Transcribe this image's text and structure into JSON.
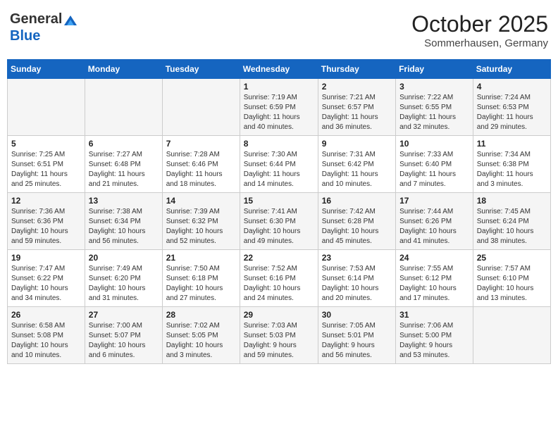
{
  "header": {
    "logo": {
      "general": "General",
      "blue": "Blue"
    },
    "title": "October 2025",
    "location": "Sommerhausen, Germany"
  },
  "weekdays": [
    "Sunday",
    "Monday",
    "Tuesday",
    "Wednesday",
    "Thursday",
    "Friday",
    "Saturday"
  ],
  "weeks": [
    {
      "days": [
        {
          "num": "",
          "info": ""
        },
        {
          "num": "",
          "info": ""
        },
        {
          "num": "",
          "info": ""
        },
        {
          "num": "1",
          "info": "Sunrise: 7:19 AM\nSunset: 6:59 PM\nDaylight: 11 hours\nand 40 minutes."
        },
        {
          "num": "2",
          "info": "Sunrise: 7:21 AM\nSunset: 6:57 PM\nDaylight: 11 hours\nand 36 minutes."
        },
        {
          "num": "3",
          "info": "Sunrise: 7:22 AM\nSunset: 6:55 PM\nDaylight: 11 hours\nand 32 minutes."
        },
        {
          "num": "4",
          "info": "Sunrise: 7:24 AM\nSunset: 6:53 PM\nDaylight: 11 hours\nand 29 minutes."
        }
      ]
    },
    {
      "days": [
        {
          "num": "5",
          "info": "Sunrise: 7:25 AM\nSunset: 6:51 PM\nDaylight: 11 hours\nand 25 minutes."
        },
        {
          "num": "6",
          "info": "Sunrise: 7:27 AM\nSunset: 6:48 PM\nDaylight: 11 hours\nand 21 minutes."
        },
        {
          "num": "7",
          "info": "Sunrise: 7:28 AM\nSunset: 6:46 PM\nDaylight: 11 hours\nand 18 minutes."
        },
        {
          "num": "8",
          "info": "Sunrise: 7:30 AM\nSunset: 6:44 PM\nDaylight: 11 hours\nand 14 minutes."
        },
        {
          "num": "9",
          "info": "Sunrise: 7:31 AM\nSunset: 6:42 PM\nDaylight: 11 hours\nand 10 minutes."
        },
        {
          "num": "10",
          "info": "Sunrise: 7:33 AM\nSunset: 6:40 PM\nDaylight: 11 hours\nand 7 minutes."
        },
        {
          "num": "11",
          "info": "Sunrise: 7:34 AM\nSunset: 6:38 PM\nDaylight: 11 hours\nand 3 minutes."
        }
      ]
    },
    {
      "days": [
        {
          "num": "12",
          "info": "Sunrise: 7:36 AM\nSunset: 6:36 PM\nDaylight: 10 hours\nand 59 minutes."
        },
        {
          "num": "13",
          "info": "Sunrise: 7:38 AM\nSunset: 6:34 PM\nDaylight: 10 hours\nand 56 minutes."
        },
        {
          "num": "14",
          "info": "Sunrise: 7:39 AM\nSunset: 6:32 PM\nDaylight: 10 hours\nand 52 minutes."
        },
        {
          "num": "15",
          "info": "Sunrise: 7:41 AM\nSunset: 6:30 PM\nDaylight: 10 hours\nand 49 minutes."
        },
        {
          "num": "16",
          "info": "Sunrise: 7:42 AM\nSunset: 6:28 PM\nDaylight: 10 hours\nand 45 minutes."
        },
        {
          "num": "17",
          "info": "Sunrise: 7:44 AM\nSunset: 6:26 PM\nDaylight: 10 hours\nand 41 minutes."
        },
        {
          "num": "18",
          "info": "Sunrise: 7:45 AM\nSunset: 6:24 PM\nDaylight: 10 hours\nand 38 minutes."
        }
      ]
    },
    {
      "days": [
        {
          "num": "19",
          "info": "Sunrise: 7:47 AM\nSunset: 6:22 PM\nDaylight: 10 hours\nand 34 minutes."
        },
        {
          "num": "20",
          "info": "Sunrise: 7:49 AM\nSunset: 6:20 PM\nDaylight: 10 hours\nand 31 minutes."
        },
        {
          "num": "21",
          "info": "Sunrise: 7:50 AM\nSunset: 6:18 PM\nDaylight: 10 hours\nand 27 minutes."
        },
        {
          "num": "22",
          "info": "Sunrise: 7:52 AM\nSunset: 6:16 PM\nDaylight: 10 hours\nand 24 minutes."
        },
        {
          "num": "23",
          "info": "Sunrise: 7:53 AM\nSunset: 6:14 PM\nDaylight: 10 hours\nand 20 minutes."
        },
        {
          "num": "24",
          "info": "Sunrise: 7:55 AM\nSunset: 6:12 PM\nDaylight: 10 hours\nand 17 minutes."
        },
        {
          "num": "25",
          "info": "Sunrise: 7:57 AM\nSunset: 6:10 PM\nDaylight: 10 hours\nand 13 minutes."
        }
      ]
    },
    {
      "days": [
        {
          "num": "26",
          "info": "Sunrise: 6:58 AM\nSunset: 5:08 PM\nDaylight: 10 hours\nand 10 minutes."
        },
        {
          "num": "27",
          "info": "Sunrise: 7:00 AM\nSunset: 5:07 PM\nDaylight: 10 hours\nand 6 minutes."
        },
        {
          "num": "28",
          "info": "Sunrise: 7:02 AM\nSunset: 5:05 PM\nDaylight: 10 hours\nand 3 minutes."
        },
        {
          "num": "29",
          "info": "Sunrise: 7:03 AM\nSunset: 5:03 PM\nDaylight: 9 hours\nand 59 minutes."
        },
        {
          "num": "30",
          "info": "Sunrise: 7:05 AM\nSunset: 5:01 PM\nDaylight: 9 hours\nand 56 minutes."
        },
        {
          "num": "31",
          "info": "Sunrise: 7:06 AM\nSunset: 5:00 PM\nDaylight: 9 hours\nand 53 minutes."
        },
        {
          "num": "",
          "info": ""
        }
      ]
    }
  ]
}
